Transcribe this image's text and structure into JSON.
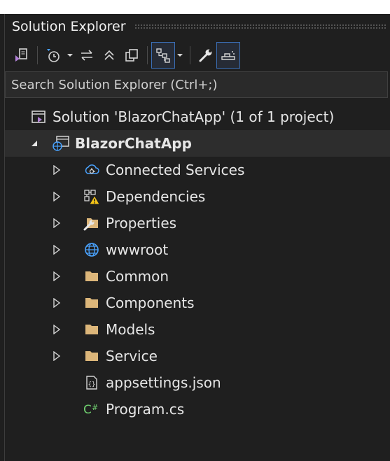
{
  "panel": {
    "title": "Solution Explorer"
  },
  "search": {
    "placeholder": "Search Solution Explorer (Ctrl+;)"
  },
  "toolbar": {
    "buttons": [
      {
        "icon": "sync-with-active-document-icon"
      },
      {
        "icon": "pending-changes-filter-icon"
      },
      {
        "icon": "dropdown-arrow-icon"
      },
      {
        "icon": "sync-arrows-icon"
      },
      {
        "icon": "collapse-all-icon"
      },
      {
        "icon": "show-all-files-icon"
      },
      {
        "icon": "file-nesting-icon"
      },
      {
        "icon": "properties-wrench-icon"
      },
      {
        "icon": "preview-selected-items-icon"
      }
    ]
  },
  "tree": {
    "solution": {
      "label": "Solution 'BlazorChatApp' (1 of 1 project)",
      "icon": "solution-icon"
    },
    "project": {
      "label": "BlazorChatApp",
      "icon": "web-project-icon",
      "expanded": true
    },
    "items": [
      {
        "label": "Connected Services",
        "icon": "connected-services-icon",
        "expandable": true
      },
      {
        "label": "Dependencies",
        "icon": "dependencies-warning-icon",
        "expandable": true
      },
      {
        "label": "Properties",
        "icon": "properties-folder-icon",
        "expandable": true
      },
      {
        "label": "wwwroot",
        "icon": "globe-icon",
        "expandable": true
      },
      {
        "label": "Common",
        "icon": "folder-icon",
        "expandable": true
      },
      {
        "label": "Components",
        "icon": "folder-icon",
        "expandable": true
      },
      {
        "label": "Models",
        "icon": "folder-icon",
        "expandable": true
      },
      {
        "label": "Service",
        "icon": "folder-icon",
        "expandable": true
      },
      {
        "label": "appsettings.json",
        "icon": "json-file-icon",
        "expandable": false
      },
      {
        "label": "Program.cs",
        "icon": "csharp-file-icon",
        "expandable": false
      }
    ]
  },
  "colors": {
    "background": "#1f1f1f",
    "accent": "#3b6fb8",
    "folder": "#dcb67a"
  }
}
